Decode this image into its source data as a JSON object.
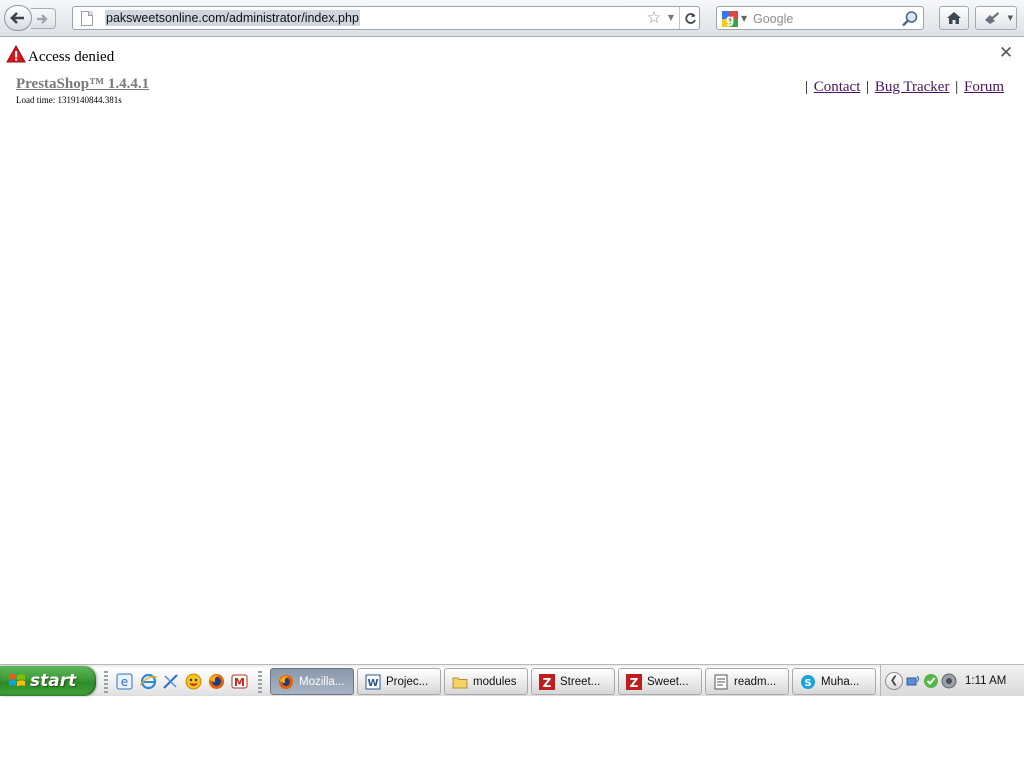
{
  "browser": {
    "url": "paksweetsonline.com/administrator/index.php",
    "search_placeholder": "Google"
  },
  "page": {
    "alert_text": "Access denied",
    "brand_link": "PrestaShop™ 1.4.4.1",
    "load_time": "Load time: 1319140844.381s",
    "footer_links": [
      {
        "label": "Contact"
      },
      {
        "label": "Bug Tracker"
      },
      {
        "label": "Forum"
      }
    ],
    "separator": "|",
    "link_color": "#4a1560",
    "brand_color": "#7a7a7a"
  },
  "taskbar": {
    "start_label": "start",
    "quick_launch": [
      "ie-edit-icon",
      "internet-explorer-icon",
      "xp-tool-icon",
      "messenger-icon",
      "firefox-icon",
      "gmail-icon"
    ],
    "tasks": [
      {
        "label": "Mozilla...",
        "icon": "firefox-icon",
        "active": true
      },
      {
        "label": "Projec...",
        "icon": "word-icon",
        "active": false
      },
      {
        "label": "modules",
        "icon": "folder-icon",
        "active": false
      },
      {
        "label": "Street...",
        "icon": "filezilla-icon",
        "active": false
      },
      {
        "label": "Sweet...",
        "icon": "filezilla-icon",
        "active": false
      },
      {
        "label": "readm...",
        "icon": "notepad-icon",
        "active": false
      },
      {
        "label": "Muha...",
        "icon": "skype-icon",
        "active": false
      }
    ],
    "clock": "1:11 AM"
  }
}
